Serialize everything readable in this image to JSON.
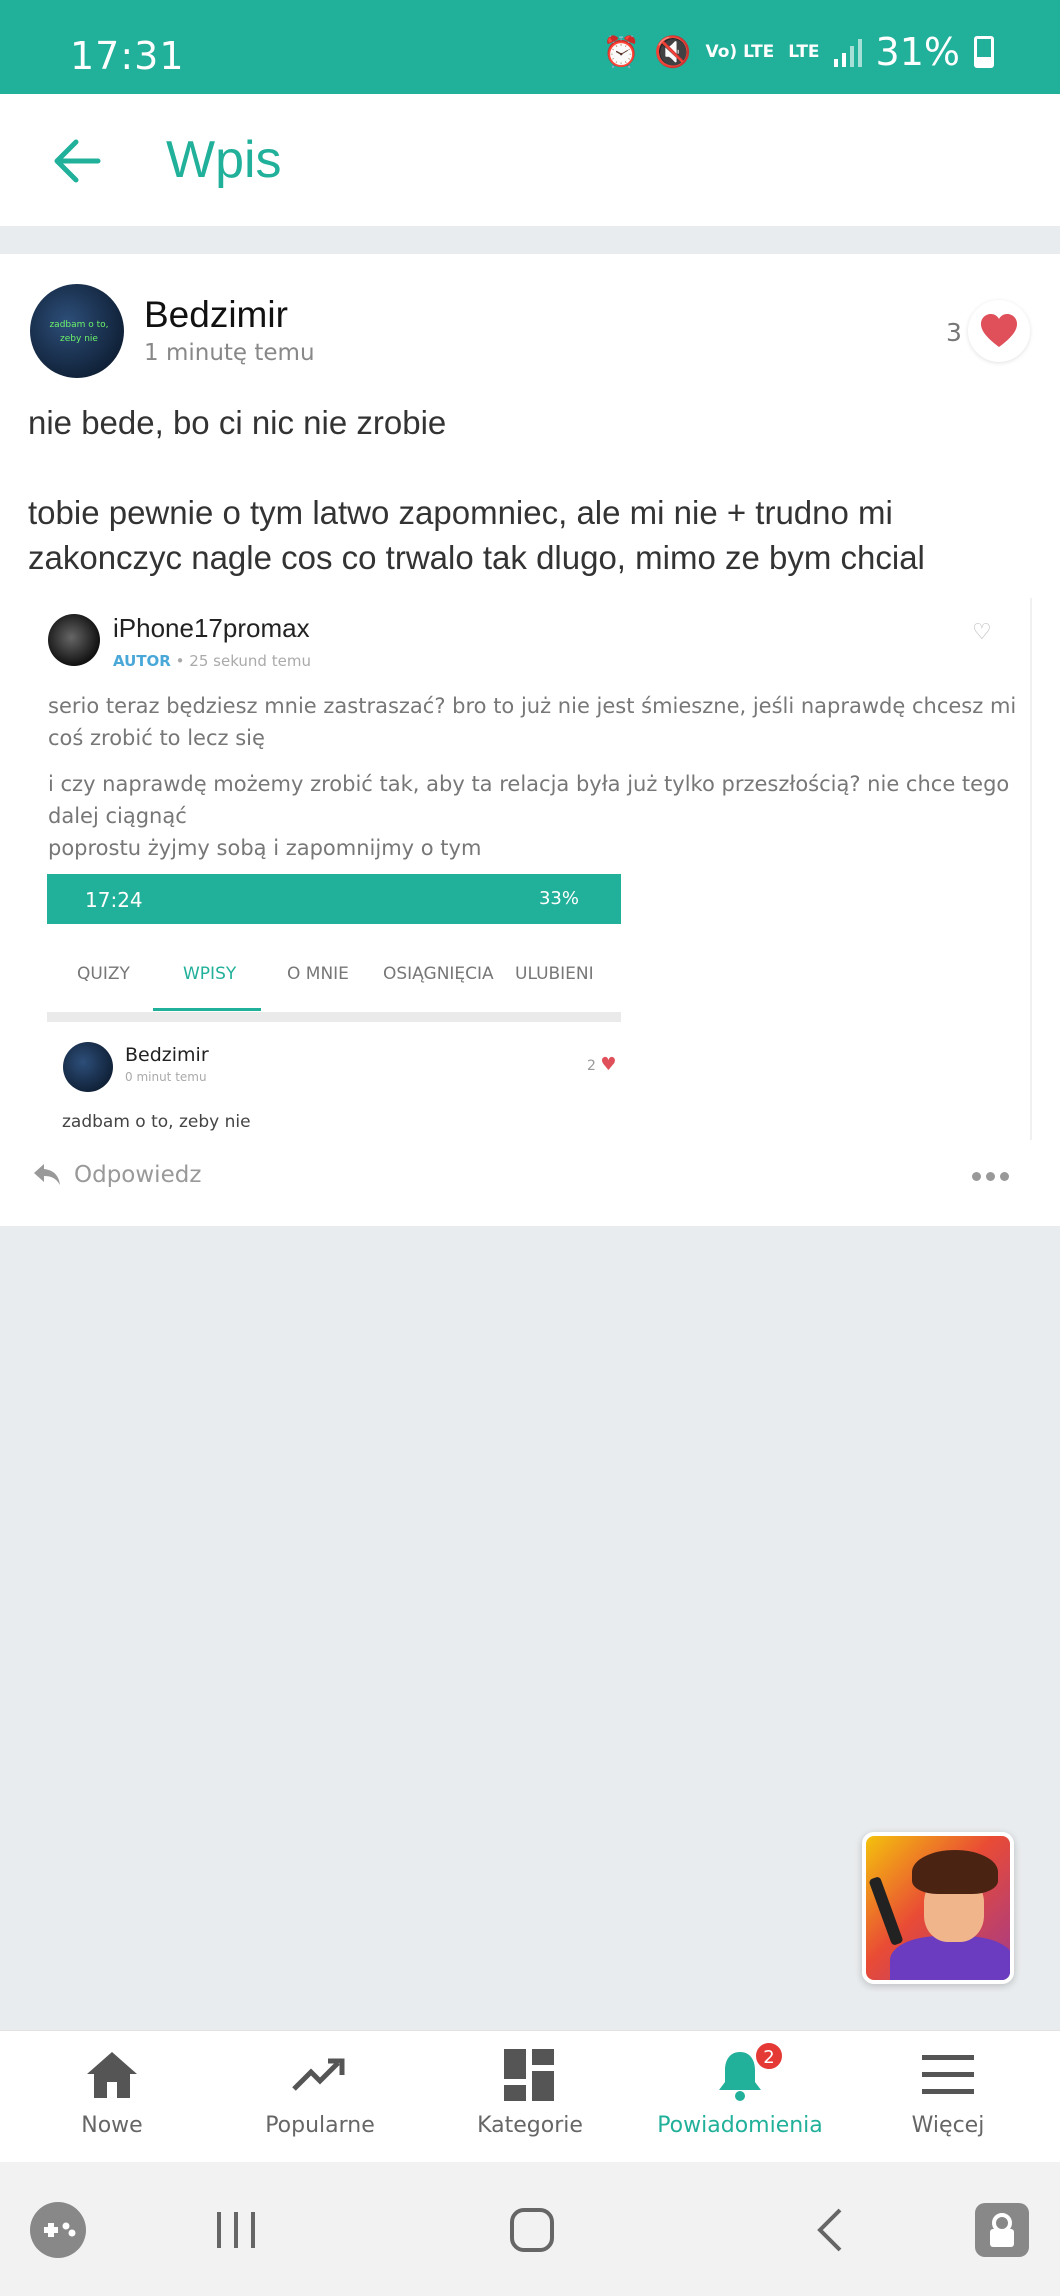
{
  "status_bar": {
    "time": "17:31",
    "network": "Vo) LTE",
    "lte": "LTE",
    "battery": "31%"
  },
  "header": {
    "title": "Wpis"
  },
  "post": {
    "author": "Bedzimir",
    "time": "1 minutę temu",
    "likes": "3",
    "paragraphs": [
      "nie bede, bo ci nic nie zrobie",
      "tobie pewnie o tym latwo zapomniec, ale mi nie + trudno mi zakonczyc nagle cos co trwalo tak dlugo, mimo ze bym chcial"
    ],
    "avatar_text": "zadbam o to, zeby nie"
  },
  "embedded_screenshot": {
    "author": "iPhone17promax",
    "role": "AUTOR",
    "sep": "•",
    "time": "25 sekund temu",
    "paragraphs": [
      "serio teraz będziesz mnie zastraszać? bro to już nie jest śmieszne, jeśli naprawdę chcesz mi coś zrobić to lecz się",
      "i czy naprawdę możemy zrobić tak, aby ta relacja była już tylko przeszłością? nie chce tego dalej ciągnąć\npoprostu żyjmy sobą i zapomnijmy o tym"
    ],
    "inner_status_time": "17:24",
    "inner_status_right": "33%",
    "tabs": [
      "QUIZY",
      "WPISY",
      "O MNIE",
      "OSIĄGNIĘCIA",
      "ULUBIENI"
    ],
    "active_tab": "WPISY",
    "inner_post": {
      "author": "Bedzimir",
      "time": "0 minut temu",
      "likes": "2",
      "text": "zadbam o to, zeby nie"
    }
  },
  "actions": {
    "reply": "Odpowiedz"
  },
  "bottom_nav": {
    "items": [
      {
        "label": "Nowe",
        "icon": "home-icon"
      },
      {
        "label": "Popularne",
        "icon": "trending-icon"
      },
      {
        "label": "Kategorie",
        "icon": "grid-icon"
      },
      {
        "label": "Powiadomienia",
        "icon": "bell-icon",
        "badge": "2",
        "active": true
      },
      {
        "label": "Więcej",
        "icon": "menu-icon"
      }
    ]
  },
  "colors": {
    "accent": "#21b09a",
    "heart": "#e0505a",
    "badge": "#e53935"
  }
}
